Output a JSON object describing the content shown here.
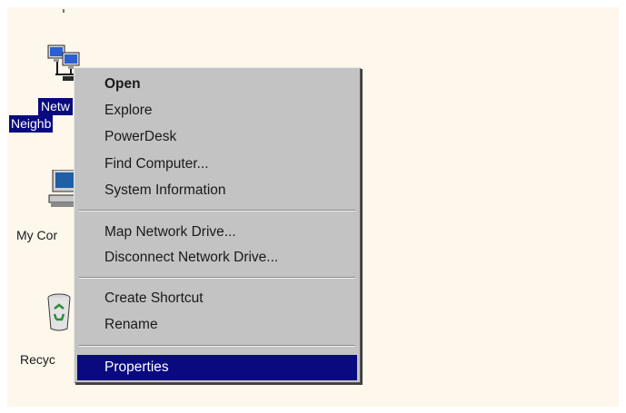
{
  "desktop": {
    "icons": [
      {
        "label_line1": "Netw",
        "label_line2": "Neighb",
        "icon": "network-neighborhood-icon",
        "selected": true
      },
      {
        "label": "My Cor",
        "icon": "my-computer-icon"
      },
      {
        "label": "Recyc",
        "icon": "recycle-bin-icon"
      }
    ]
  },
  "context_menu": {
    "items": [
      {
        "label": "Open",
        "bold": true,
        "access_key": "O"
      },
      {
        "label": "Explore",
        "access_key": "E"
      },
      {
        "label": "PowerDesk",
        "access_key": "P"
      },
      {
        "label": "Find Computer...",
        "access_key": "F"
      },
      {
        "label": "System Information"
      },
      {
        "label": "Map Network Drive...",
        "access_key": "N"
      },
      {
        "label": "Disconnect Network Drive...",
        "access_key": "D"
      },
      {
        "label": "Create Shortcut",
        "access_key": "S"
      },
      {
        "label": "Rename",
        "access_key": "m"
      },
      {
        "label": "Properties",
        "highlighted": true,
        "access_key": "r"
      }
    ]
  },
  "colors": {
    "desktop_bg": "#fdf7ec",
    "menu_bg": "#c3c3c3",
    "highlight": "#0a0a80"
  }
}
